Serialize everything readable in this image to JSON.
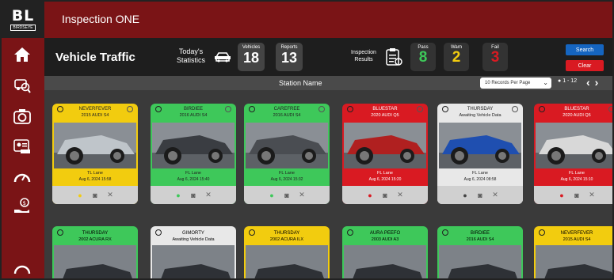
{
  "app": {
    "logo": "BL",
    "logo_sub": "BIRDSEYE",
    "title": "Inspection ONE"
  },
  "sidebar": {
    "items": [
      "home-icon",
      "inspection-icon",
      "camera-icon",
      "id-card-icon",
      "gauge-icon",
      "hand-money-icon"
    ]
  },
  "header": {
    "page_title": "Vehicle Traffic",
    "todays_statistics": "Today's\nStatistics",
    "vehicles_label": "Vehicles",
    "vehicles_value": "18",
    "reports_label": "Reports",
    "reports_value": "13",
    "inspection_results": "Inspection\nResults",
    "pass_label": "Pass",
    "pass_value": "8",
    "warn_label": "Warn",
    "warn_value": "2",
    "fail_label": "Fail",
    "fail_value": "3",
    "search_label": "Search",
    "clear_label": "Clear"
  },
  "subbar": {
    "station_name": "Station Name",
    "records_per_page": "10 Records Per Page",
    "page_range": "1 - 12"
  },
  "colors": {
    "pass": "#3ec85a",
    "warn": "#f2cc0f",
    "fail": "#d91a22",
    "pending": "#e8e8e8",
    "accent": "#7a1416"
  },
  "cards": [
    {
      "status": "warn",
      "day": "NEVERFEVER",
      "model": "2015 AUDI S4",
      "lane": "TL Lane",
      "date": "Aug 6, 2024 15:58"
    },
    {
      "status": "pass",
      "day": "BIRDIEE",
      "model": "2016 AUDI S4",
      "lane": "FL Lane",
      "date": "Aug 6, 2024 15:40"
    },
    {
      "status": "pass",
      "day": "CAREFREE",
      "model": "2016 AUDI S4",
      "lane": "FL Lane",
      "date": "Aug 6, 2024 15:32"
    },
    {
      "status": "fail",
      "day": "BLUESTAR",
      "model": "2020 AUDI Q5",
      "lane": "FL Lane",
      "date": "Aug 6, 2024 15:20"
    },
    {
      "status": "pending",
      "day": "THURSDAY",
      "model": "Awaiting Vehicle Data",
      "lane": "FL Lane",
      "date": "Aug 6, 2024 08:58"
    },
    {
      "status": "fail",
      "day": "BLUESTAR",
      "model": "2020 AUDI Q5",
      "lane": "FL Lane",
      "date": "Aug 6, 2024 15:10"
    }
  ],
  "cards_row2": [
    {
      "status": "pass",
      "day": "THURSDAY",
      "model": "2002 ACURA RX"
    },
    {
      "status": "pending",
      "day": "GIMORTY",
      "model": "Awaiting Vehicle Data"
    },
    {
      "status": "warn",
      "day": "THURSDAY",
      "model": "2002 ACURA ILX"
    },
    {
      "status": "pass",
      "day": "AURA PEEFO",
      "model": "2003 AUDI A3"
    },
    {
      "status": "pass",
      "day": "BIRDIEE",
      "model": "2016 AUDI S4"
    },
    {
      "status": "warn",
      "day": "NEVERFEVER",
      "model": "2015 AUDI S4"
    }
  ]
}
